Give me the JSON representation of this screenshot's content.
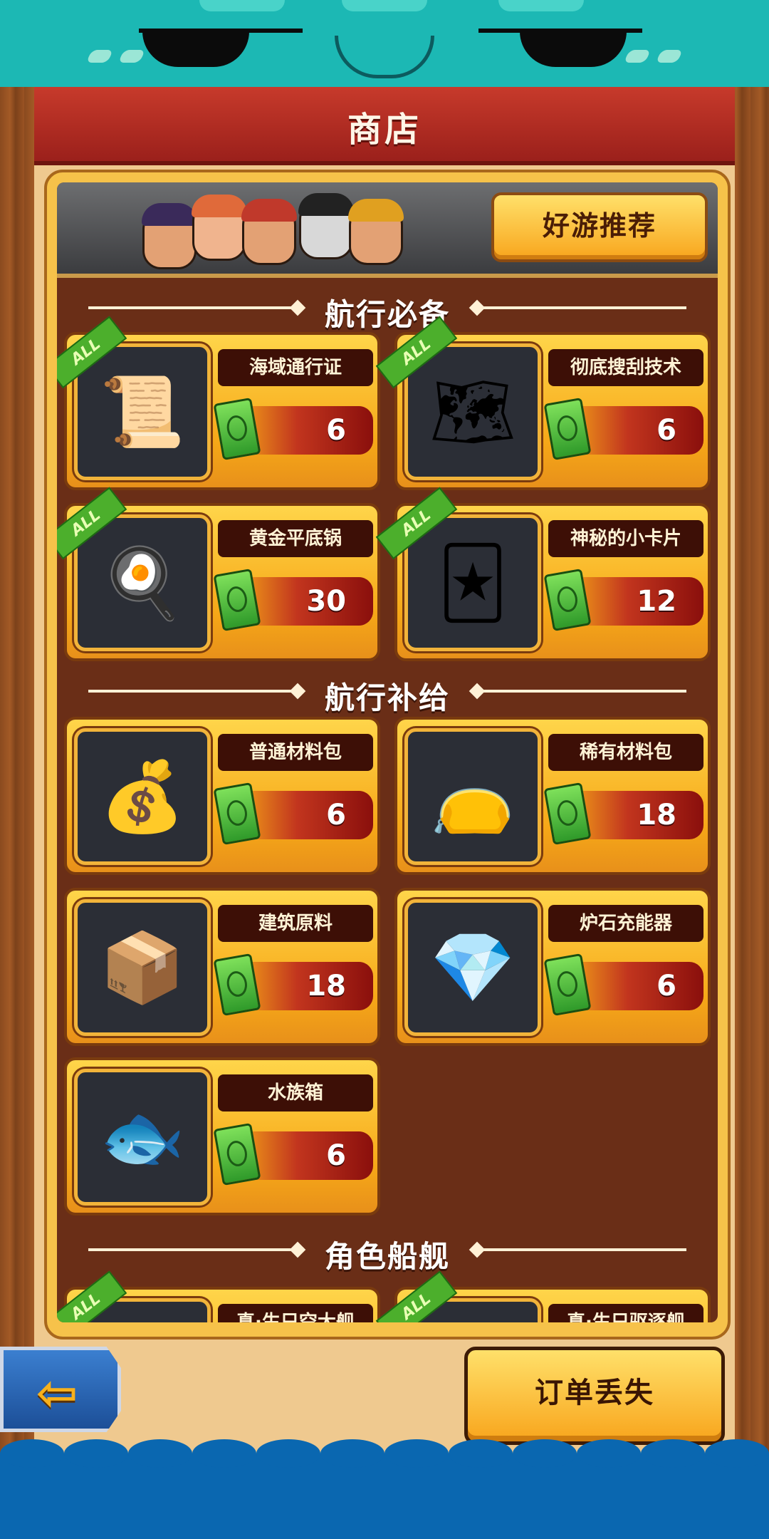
{
  "header": {
    "title": "商店"
  },
  "banner": {
    "recommend_label": "好游推荐"
  },
  "sections": [
    {
      "label": "航行必备"
    },
    {
      "label": "航行补给"
    },
    {
      "label": "角色船舰"
    }
  ],
  "items": [
    {
      "name": "海域通行证",
      "price": "6",
      "badge": "ALL",
      "icon": "map-scroll-icon"
    },
    {
      "name": "彻底搜刮技术",
      "price": "6",
      "badge": "ALL",
      "icon": "treasure-scroll-icon"
    },
    {
      "name": "黄金平底锅",
      "price": "30",
      "badge": "ALL",
      "icon": "golden-pan-icon"
    },
    {
      "name": "神秘的小卡片",
      "price": "12",
      "badge": "ALL",
      "icon": "dragon-card-icon"
    },
    {
      "name": "普通材料包",
      "price": "6",
      "icon": "material-bag-icon"
    },
    {
      "name": "稀有材料包",
      "price": "18",
      "icon": "rare-bag-icon"
    },
    {
      "name": "建筑原料",
      "price": "18",
      "icon": "building-crate-icon"
    },
    {
      "name": "炉石充能器",
      "price": "6",
      "icon": "crystal-charger-icon"
    },
    {
      "name": "水族箱",
      "price": "6",
      "icon": "aquarium-icon"
    }
  ],
  "partial_items": [
    {
      "name": "真·生只空大舰",
      "badge": "ALL"
    },
    {
      "name": "真·生只驱逐舰",
      "badge": "ALL"
    }
  ],
  "bottom": {
    "order_lost_label": "订单丢失",
    "back_icon": "back-arrow-icon"
  },
  "colors": {
    "teal": "#1cb8b4",
    "header_red": "#c73a2b",
    "gold": "#f6c24a",
    "panel_brown": "#6a2e17",
    "sea_blue": "#0a67b0"
  }
}
